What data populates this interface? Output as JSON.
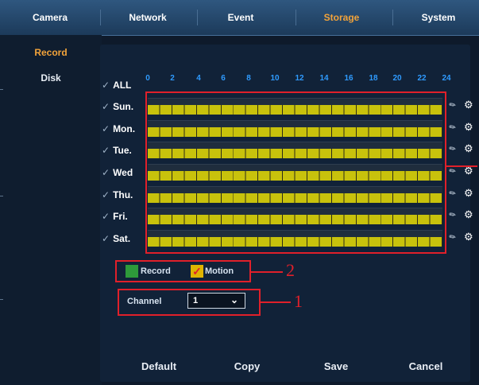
{
  "tabs": [
    {
      "label": "Camera",
      "active": false
    },
    {
      "label": "Network",
      "active": false
    },
    {
      "label": "Event",
      "active": false
    },
    {
      "label": "Storage",
      "active": true
    },
    {
      "label": "System",
      "active": false
    }
  ],
  "sidebar": {
    "items": [
      {
        "label": "Record",
        "active": true
      },
      {
        "label": "Disk",
        "active": false
      }
    ]
  },
  "schedule": {
    "all_label": "ALL",
    "hours": [
      "0",
      "2",
      "4",
      "6",
      "8",
      "10",
      "12",
      "14",
      "16",
      "18",
      "20",
      "22",
      "24"
    ],
    "days": [
      "Sun.",
      "Mon.",
      "Tue.",
      "Wed",
      "Thu.",
      "Fri.",
      "Sat."
    ],
    "check_icon": "checkmark-icon",
    "row_icons": [
      "pen-icon",
      "gear-icon"
    ],
    "record_color": "#c8c20c"
  },
  "legend": {
    "record_label": "Record",
    "record_color": "#2e9a3a",
    "motion_label": "Motion",
    "motion_color": "#e0b400"
  },
  "channel": {
    "label": "Channel",
    "value": "1"
  },
  "buttons": {
    "default": "Default",
    "copy": "Copy",
    "save": "Save",
    "cancel": "Cancel"
  },
  "callouts": {
    "one": "1",
    "two": "2"
  },
  "annotation_color": "#e0202a"
}
